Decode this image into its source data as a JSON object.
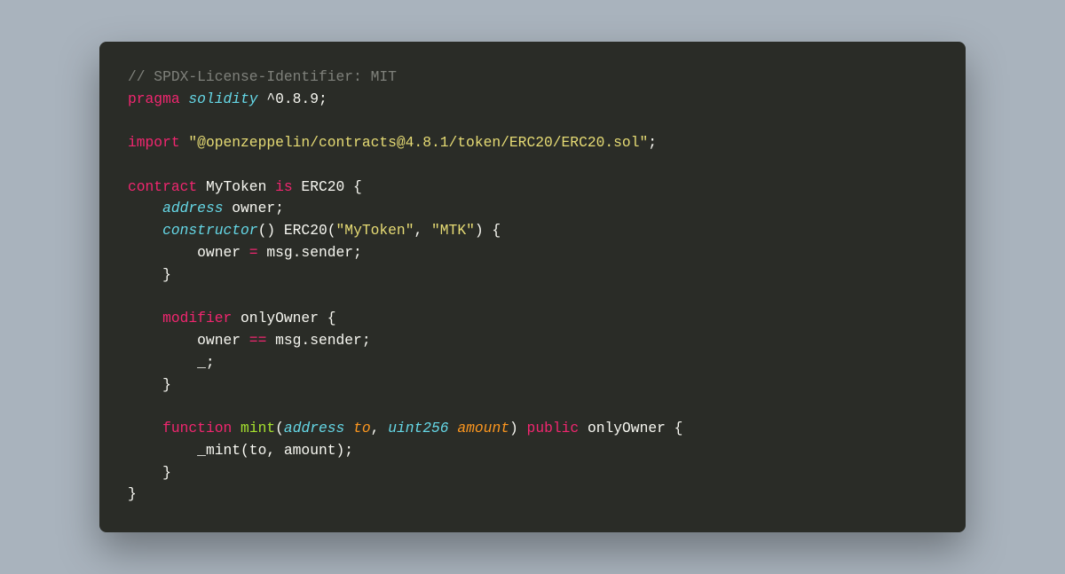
{
  "code": {
    "l1_comment": "// SPDX-License-Identifier: MIT",
    "l2_pragma": "pragma",
    "l2_solidity": "solidity",
    "l2_version": " ^0.8.9;",
    "l4_import": "import",
    "l4_path": "\"@openzeppelin/contracts@4.8.1/token/ERC20/ERC20.sol\"",
    "l4_semi": ";",
    "l6_contract": "contract",
    "l6_name": " MyToken ",
    "l6_is": "is",
    "l6_ext": " ERC20 {",
    "l7_indent": "    ",
    "l7_type": "address",
    "l7_rest": " owner;",
    "l8_indent": "    ",
    "l8_ctor": "constructor",
    "l8_parens": "() ",
    "l8_erc": "ERC20",
    "l8_open": "(",
    "l8_s1": "\"MyToken\"",
    "l8_comma": ", ",
    "l8_s2": "\"MTK\"",
    "l8_close": ") {",
    "l9": "        owner = msg.sender;",
    "l9a": "        owner ",
    "l9op": "=",
    "l9b": " msg.sender;",
    "l10": "    }",
    "l12_indent": "    ",
    "l12_mod": "modifier",
    "l12_name": " onlyOwner {",
    "l13a": "        owner ",
    "l13op": "==",
    "l13b": " msg.sender;",
    "l14": "        _;",
    "l15": "    }",
    "l17_indent": "    ",
    "l17_fn": "function",
    "l17_sp": " ",
    "l17_name": "mint",
    "l17_open": "(",
    "l17_t1": "address",
    "l17_p1": " to",
    "l17_c": ", ",
    "l17_t2": "uint256",
    "l17_p2": " amount",
    "l17_close": ") ",
    "l17_pub": "public",
    "l17_rest": " onlyOwner {",
    "l18a": "        ",
    "l18fn": "_mint",
    "l18b": "(to, amount);",
    "l19": "    }",
    "l20": "}"
  }
}
